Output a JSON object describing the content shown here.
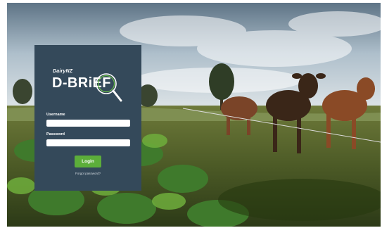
{
  "logo": {
    "brand": "DairyNZ",
    "product": "D-BRiEF",
    "icon": "magnifier-icon"
  },
  "form": {
    "username_label": "Username",
    "username_value": "",
    "password_label": "Password",
    "password_value": "",
    "login_label": "Login",
    "forgot_label": "Forgot password?"
  },
  "colors": {
    "panel": "#34495a",
    "login_button": "#5cae3a",
    "accent_ring": "#6cc24a"
  },
  "background": {
    "scene": "cows-in-field-photo"
  }
}
